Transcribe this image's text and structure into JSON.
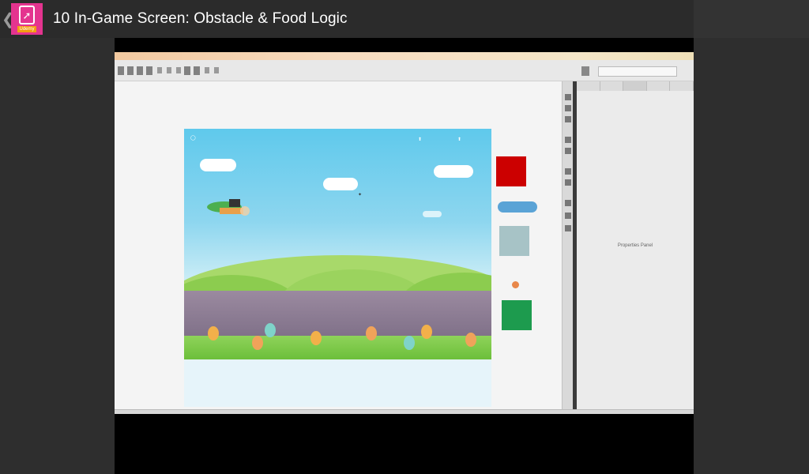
{
  "action_bar": {
    "up_caret": "❮",
    "logo_glyph": "🚀",
    "logo_brand": "Udemy",
    "title": "10  In-Game Screen: Obstacle & Food Logic"
  },
  "video": {
    "ide_panel_empty_text": "Properties Panel"
  },
  "colors": {
    "action_bar": "#2b2b2b",
    "logo": "#e4348f",
    "asset_red": "#cc0000",
    "asset_gray": "#a7c3c6",
    "asset_green": "#1d9b4e"
  }
}
